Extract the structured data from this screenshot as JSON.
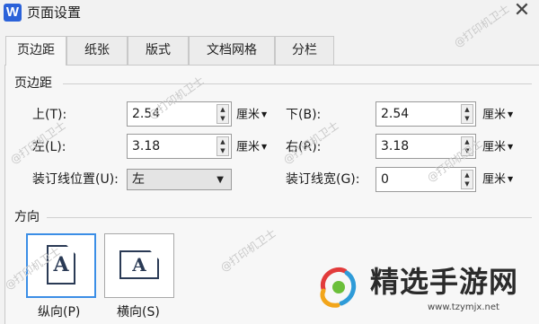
{
  "app_icon": "W",
  "title": "页面设置",
  "close": "✕",
  "tabs": [
    "页边距",
    "纸张",
    "版式",
    "文档网格",
    "分栏"
  ],
  "margins_section": "页边距",
  "top_label": "上(T):",
  "top_value": "2.54",
  "bottom_label": "下(B):",
  "bottom_value": "2.54",
  "left_label": "左(L):",
  "left_value": "3.18",
  "right_label": "右(R):",
  "right_value": "3.18",
  "gutter_pos_label": "装订线位置(U):",
  "gutter_pos_value": "左",
  "gutter_width_label": "装订线宽(G):",
  "gutter_width_value": "0",
  "unit": "厘米",
  "orientation_section": "方向",
  "portrait_label": "纵向(P)",
  "landscape_label": "横向(S)",
  "page_glyph": "A",
  "watermark": "@打印机卫士",
  "brand_name": "精选手游网",
  "brand_url": "www.tzymjx.net",
  "colors": {
    "accent": "#3b8ee6",
    "app_icon": "#2b62d9"
  }
}
